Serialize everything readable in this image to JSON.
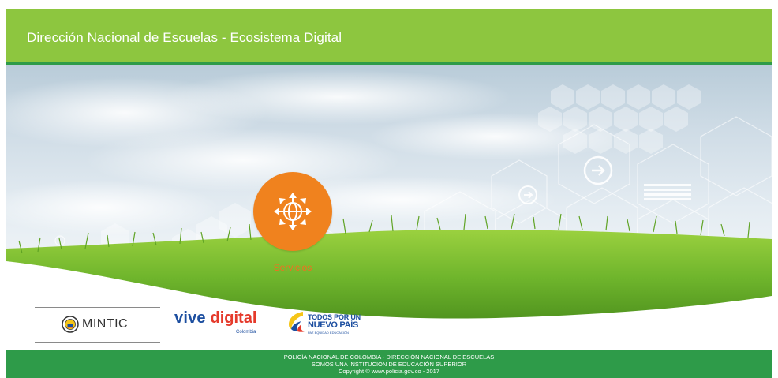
{
  "header": {
    "title": "Dirección Nacional de Escuelas - Ecosistema Digital"
  },
  "services": {
    "label": "Servicios",
    "icon": "globe-arrows-icon",
    "color": "#f0821e"
  },
  "logos": {
    "mintic": "MINTIC",
    "vive_part1": "vive ",
    "vive_part2": "digital",
    "vive_sub": "Colombia",
    "todos_line1": "TODOS POR UN",
    "todos_line2": "NUEVO PAÍS",
    "todos_line3": "PAZ EQUIDAD EDUCACIÓN"
  },
  "footer": {
    "line1": "POLICÍA NACIONAL DE COLOMBIA - DIRECCIÓN NACIONAL DE ESCUELAS",
    "line2": "SOMOS UNA INSTITUCIÓN DE EDUCACIÓN SUPERIOR",
    "line3": "Copyright © www.policia.gov.co - 2017"
  },
  "colors": {
    "header_green": "#8dc63f",
    "footer_green": "#2e9b49",
    "accent_orange": "#f0821e"
  }
}
